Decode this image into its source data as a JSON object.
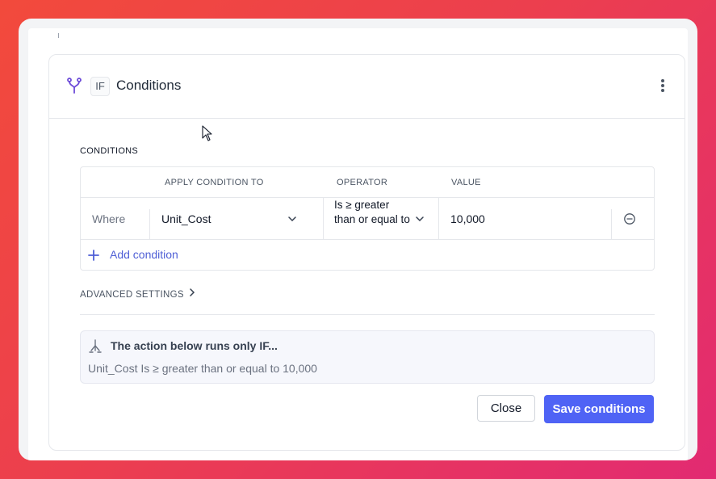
{
  "colors": {
    "accent": "#4f63f5",
    "link": "#4f5fd6",
    "icon_purple": "#6d4bd8",
    "background_gradient_start": "#f24a3c",
    "background_gradient_end": "#e22a72"
  },
  "header": {
    "branch_icon": "branch-icon",
    "badge": "IF",
    "title": "Conditions",
    "menu_icon": "kebab-menu-icon"
  },
  "conditions": {
    "section_label": "CONDITIONS",
    "columns": {
      "apply_to": "APPLY CONDITION TO",
      "operator": "OPERATOR",
      "value": "VALUE"
    },
    "rows": [
      {
        "prefix": "Where",
        "field": "Unit_Cost",
        "operator": "Is ≥ greater than or equal to",
        "value": "10,000"
      }
    ],
    "add_label": "Add condition"
  },
  "advanced": {
    "label": "ADVANCED SETTINGS"
  },
  "summary": {
    "title": "The action below runs only IF...",
    "text": "Unit_Cost Is ≥ greater than or equal to 10,000"
  },
  "buttons": {
    "close": "Close",
    "save": "Save conditions"
  }
}
